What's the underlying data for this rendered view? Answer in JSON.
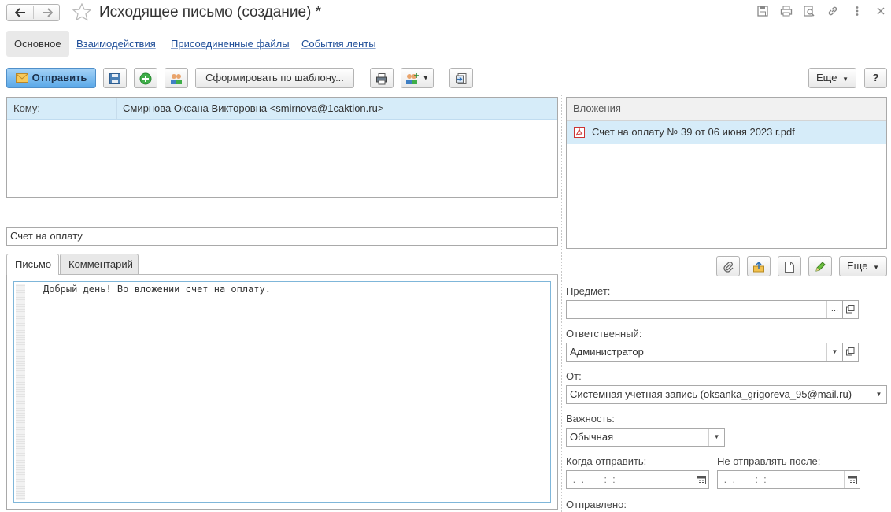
{
  "window": {
    "title": "Исходящее письмо (создание) *",
    "back_icon": "arrow-left-icon",
    "forward_icon": "arrow-right-icon"
  },
  "tabs": [
    {
      "label": "Основное",
      "active": true
    },
    {
      "label": "Взаимодействия",
      "active": false
    },
    {
      "label": "Присоединенные файлы",
      "active": false
    },
    {
      "label": "События ленты",
      "active": false
    }
  ],
  "toolbar": {
    "send_label": "Отправить",
    "template_label": "Сформировать по шаблону...",
    "more_label": "Еще",
    "help_label": "?"
  },
  "recipients": {
    "to_label": "Кому:",
    "to_value": "Смирнова Оксана Викторовна <smirnova@1caktion.ru>"
  },
  "subject_value": "Счет на оплату",
  "body_tabs": [
    {
      "label": "Письмо",
      "active": true
    },
    {
      "label": "Комментарий",
      "active": false
    }
  ],
  "body_text": "Добрый день! Во вложении счет на оплату.",
  "attachments": {
    "header": "Вложения",
    "items": [
      {
        "name": "Счет на оплату № 39 от 06 июня 2023 г.pdf",
        "icon": "pdf-file-icon"
      }
    ],
    "more_label": "Еще"
  },
  "fields": {
    "subject_label": "Предмет:",
    "subject_value": "",
    "subject_button": "...",
    "responsible_label": "Ответственный:",
    "responsible_value": "Администратор",
    "from_label": "От:",
    "from_value": "Системная учетная запись (oksanka_grigoreva_95@mail.ru)",
    "importance_label": "Важность:",
    "importance_value": "Обычная",
    "send_when_label": "Когда отправить:",
    "send_when_value": " .  .       :  :",
    "not_after_label": "Не отправлять после:",
    "not_after_value": " .  .       :  :",
    "sent_label": "Отправлено:"
  },
  "colors": {
    "accent": "#1f4e98",
    "primary_button": "#5aa8e8",
    "selection": "#d6ecf9"
  }
}
